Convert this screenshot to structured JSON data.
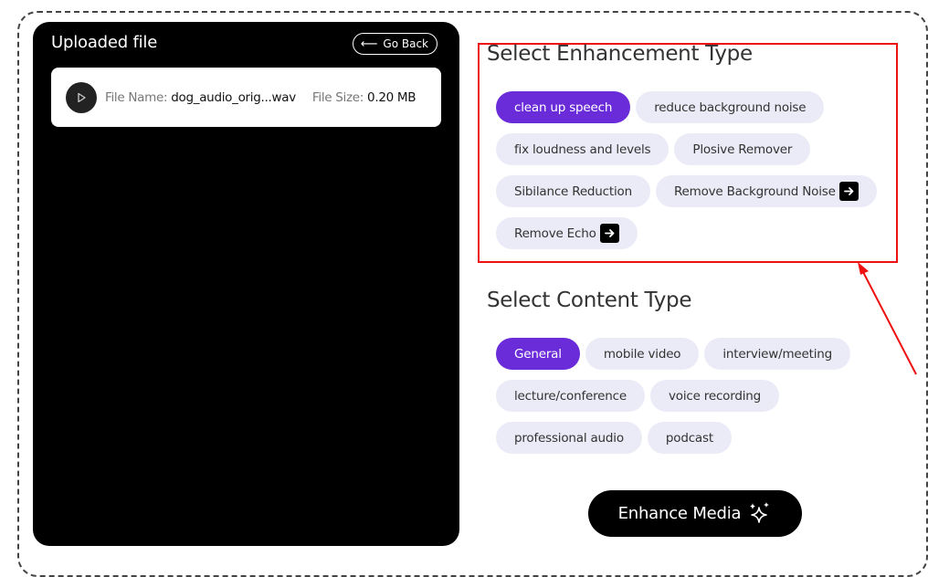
{
  "uploaded": {
    "title": "Uploaded file",
    "go_back_label": "Go Back",
    "file_name_label": "File Name:",
    "file_name": "dog_audio_orig...wav",
    "file_size_label": "File Size:",
    "file_size": "0.20 MB"
  },
  "enhancement": {
    "title": "Select Enhancement Type",
    "options": [
      {
        "label": "clean up speech",
        "selected": true,
        "has_arrow": false
      },
      {
        "label": "reduce background noise",
        "selected": false,
        "has_arrow": false
      },
      {
        "label": "fix loudness and levels",
        "selected": false,
        "has_arrow": false
      },
      {
        "label": "Plosive Remover",
        "selected": false,
        "has_arrow": false
      },
      {
        "label": "Sibilance Reduction",
        "selected": false,
        "has_arrow": false
      },
      {
        "label": "Remove Background Noise",
        "selected": false,
        "has_arrow": true
      },
      {
        "label": "Remove Echo",
        "selected": false,
        "has_arrow": true
      }
    ]
  },
  "content": {
    "title": "Select Content Type",
    "options": [
      {
        "label": "General",
        "selected": true
      },
      {
        "label": "mobile video",
        "selected": false
      },
      {
        "label": "interview/meeting",
        "selected": false
      },
      {
        "label": "lecture/conference",
        "selected": false
      },
      {
        "label": "voice recording",
        "selected": false
      },
      {
        "label": "professional audio",
        "selected": false
      },
      {
        "label": "podcast",
        "selected": false
      }
    ]
  },
  "action": {
    "enhance_label": "Enhance Media"
  },
  "colors": {
    "accent": "#6a2bd9",
    "chip_bg": "#ebebf7",
    "annotation": "#e11111"
  }
}
